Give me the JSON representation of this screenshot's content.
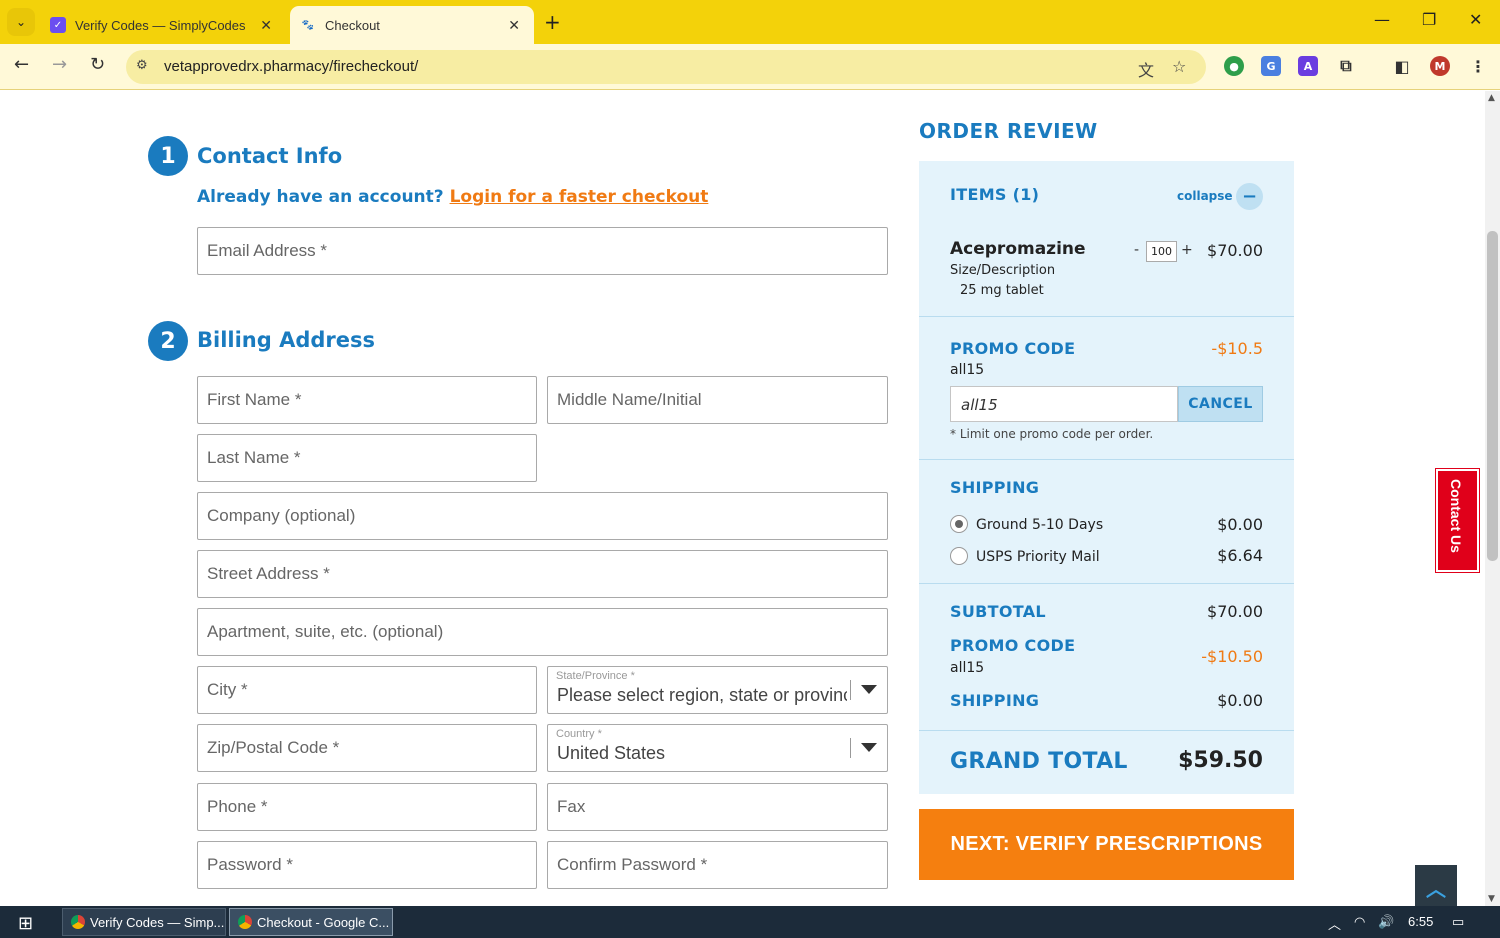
{
  "browser": {
    "tabs": [
      {
        "title": "Verify Codes — SimplyCodes",
        "active": false
      },
      {
        "title": "Checkout",
        "active": true
      }
    ],
    "url": "vetapprovedrx.pharmacy/firecheckout/",
    "profile_initial": "M",
    "accent": "#f3d20a"
  },
  "contact": {
    "step": "1",
    "title": "Contact Info",
    "account_prompt": "Already have an account?",
    "login_link": "Login for a faster checkout",
    "email_placeholder": "Email Address *"
  },
  "billing": {
    "step": "2",
    "title": "Billing Address",
    "first_name": "First Name *",
    "middle_name": "Middle Name/Initial",
    "last_name": "Last Name *",
    "company": "Company (optional)",
    "street": "Street Address *",
    "apartment": "Apartment, suite, etc. (optional)",
    "city": "City *",
    "state_label": "State/Province *",
    "state_value": "Please select region, state or province",
    "zip": "Zip/Postal Code *",
    "country_label": "Country *",
    "country_value": "United States",
    "phone": "Phone *",
    "fax": "Fax",
    "password": "Password *",
    "confirm_password": "Confirm Password *"
  },
  "review": {
    "title": "ORDER REVIEW",
    "items_label": "ITEMS (1)",
    "collapse": "collapse",
    "item": {
      "name": "Acepromazine",
      "size_label": "Size/Description",
      "size_value": "25 mg tablet",
      "qty": "100",
      "minus": "-",
      "plus": "+",
      "price": "$70.00"
    },
    "promo": {
      "label": "PROMO CODE",
      "code": "all15",
      "discount": "-$10.5",
      "input_value": "all15",
      "cancel": "CANCEL",
      "note": "* Limit one promo code per order."
    },
    "shipping": {
      "label": "SHIPPING",
      "options": [
        {
          "name": "Ground 5-10 Days",
          "price": "$0.00",
          "selected": true
        },
        {
          "name": "USPS Priority Mail",
          "price": "$6.64",
          "selected": false
        }
      ]
    },
    "totals": {
      "subtotal_label": "SUBTOTAL",
      "subtotal": "$70.00",
      "promo_label": "PROMO CODE",
      "promo_code": "all15",
      "promo_amount": "-$10.50",
      "shipping_label": "SHIPPING",
      "shipping": "$0.00",
      "grand_label": "GRAND TOTAL",
      "grand": "$59.50"
    },
    "next_button": "NEXT: VERIFY PRESCRIPTIONS"
  },
  "contact_us": "Contact Us",
  "taskbar": {
    "items": [
      "Verify Codes — Simp...",
      "Checkout - Google C..."
    ],
    "time": "6:55"
  }
}
